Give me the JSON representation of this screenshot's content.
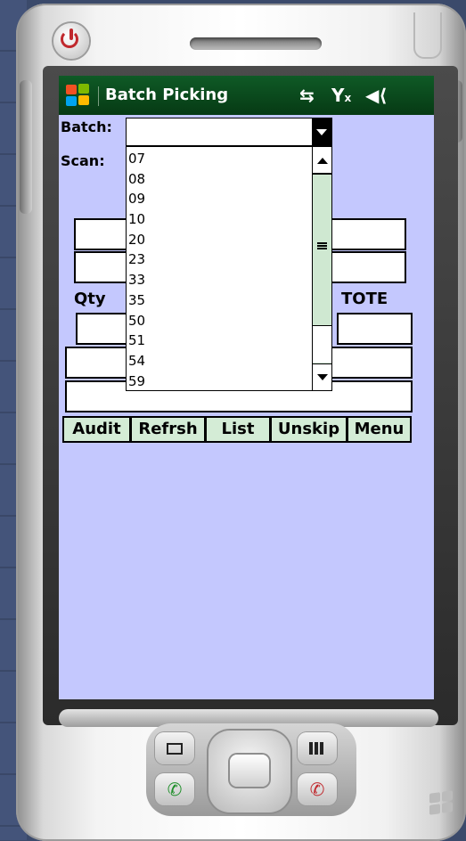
{
  "app": {
    "title": "Batch Picking",
    "tray_icons": [
      "sync-icon",
      "no-signal-icon",
      "speaker-icon"
    ]
  },
  "form": {
    "batch_label": "Batch:",
    "scan_label": "Scan:",
    "qty_label": "Qty",
    "tote_label": "TOTE",
    "batch_value": ""
  },
  "batch_dropdown": {
    "options": [
      "07",
      "08",
      "09",
      "10",
      "20",
      "23",
      "33",
      "35",
      "50",
      "51",
      "54",
      "59"
    ]
  },
  "buttons": {
    "audit": "Audit",
    "refresh": "Refrsh",
    "list": "List",
    "unskip": "Unskip",
    "menu": "Menu"
  },
  "colors": {
    "titlebar": "#06401a",
    "screen_bg": "#c4c8fe",
    "button_bg": "#d4ecd6",
    "power_icon": "#c0282d"
  }
}
